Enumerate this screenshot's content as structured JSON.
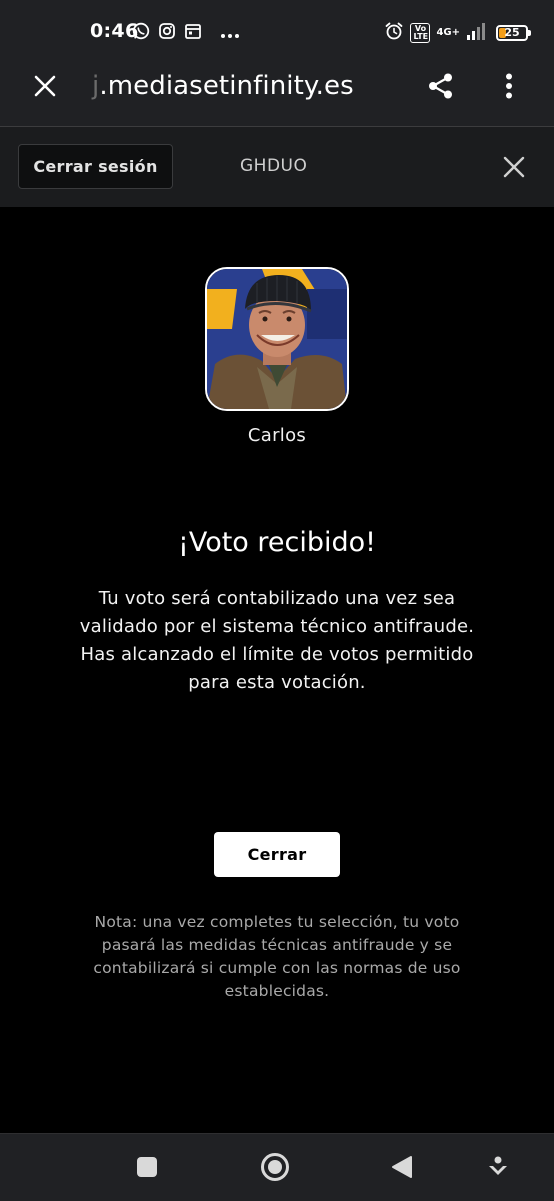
{
  "status_bar": {
    "time": "0:46",
    "network": "4G+",
    "volte": "Vo LTE",
    "battery_level": "25",
    "battery_fraction": 0.25
  },
  "browser": {
    "url_faded": "j",
    "url_domain": ".mediasetinfinity.es"
  },
  "session": {
    "logout_label": "Cerrar sesión",
    "username": "GHDUO"
  },
  "vote": {
    "candidate_name": "Carlos",
    "title": "¡Voto recibido!",
    "message": "Tu voto será contabilizado una vez sea validado por el sistema técnico antifraude. Has alcanzado el límite de votos permitido para esta votación.",
    "close_label": "Cerrar",
    "note": "Nota: una vez completes tu selección, tu voto pasará las medidas técnicas antifraude y se contabilizará si cumple con las normas de uso establecidas."
  },
  "colors": {
    "status_bg": "#202124",
    "session_bg": "#1b1c1e",
    "content_bg": "#000000",
    "battery_accent": "#f29e1a",
    "avatar_bg_blue": "#2a3f8f",
    "avatar_bg_yellow": "#f2b01e"
  },
  "icons": {
    "status_left": [
      "whatsapp-icon",
      "instagram-icon",
      "calendar-icon",
      "more-notifications-icon"
    ],
    "status_right": [
      "alarm-icon",
      "volte-icon",
      "signal-icon",
      "battery-icon"
    ],
    "toolbar": [
      "close-icon",
      "share-icon",
      "overflow-menu-icon"
    ],
    "nav": [
      "recents-square-icon",
      "home-circle-icon",
      "back-triangle-icon",
      "assistant-icon"
    ]
  }
}
